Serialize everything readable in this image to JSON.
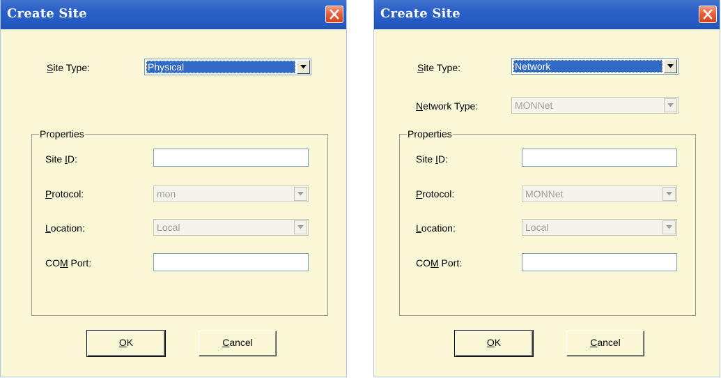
{
  "dialogs": [
    {
      "title": "Create Site",
      "site_type": {
        "label_pre": "",
        "label_key": "S",
        "label_post": "ite Type:",
        "value": "Physical"
      },
      "properties": {
        "legend": "Properties",
        "site_id": {
          "label_pre": "Site ",
          "label_key": "I",
          "label_post": "D:",
          "value": ""
        },
        "protocol": {
          "label_pre": "",
          "label_key": "P",
          "label_post": "rotocol:",
          "value": "mon"
        },
        "location": {
          "label_pre": "",
          "label_key": "L",
          "label_post": "ocation:",
          "value": "Local"
        },
        "com_port": {
          "label_pre": "CO",
          "label_key": "M",
          "label_post": " Port:",
          "value": ""
        }
      },
      "ok": {
        "pre": "",
        "key": "O",
        "post": "K"
      },
      "cancel": {
        "pre": "",
        "key": "C",
        "post": "ancel"
      }
    },
    {
      "title": "Create Site",
      "site_type": {
        "label_pre": "",
        "label_key": "S",
        "label_post": "ite Type:",
        "value": "Network"
      },
      "network_type": {
        "label_pre": "",
        "label_key": "N",
        "label_post": "etwork Type:",
        "value": "MONNet"
      },
      "properties": {
        "legend": "Properties",
        "site_id": {
          "label_pre": "Site ",
          "label_key": "I",
          "label_post": "D:",
          "value": ""
        },
        "protocol": {
          "label_pre": "",
          "label_key": "P",
          "label_post": "rotocol:",
          "value": "MONNet"
        },
        "location": {
          "label_pre": "",
          "label_key": "L",
          "label_post": "ocation:",
          "value": "Local"
        },
        "com_port": {
          "label_pre": "CO",
          "label_key": "M",
          "label_post": " Port:",
          "value": ""
        }
      },
      "ok": {
        "pre": "",
        "key": "O",
        "post": "K"
      },
      "cancel": {
        "pre": "",
        "key": "C",
        "post": "ancel"
      }
    }
  ],
  "icons": {
    "close": "close-icon",
    "dropdown": "chevron-down-icon"
  },
  "colors": {
    "dialog_background": "#fbf8d7",
    "titlebar": "#2d62c8",
    "close_button": "#e55c3a",
    "selection": "#316ac5",
    "disabled_text": "#a0a0a0"
  }
}
